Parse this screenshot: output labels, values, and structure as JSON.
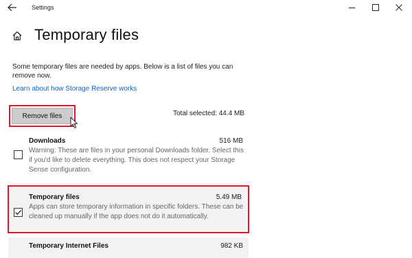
{
  "window": {
    "title": "Settings",
    "controls": {
      "minimize": "–",
      "maximize": "☐",
      "close": "✕"
    }
  },
  "page": {
    "title": "Temporary files",
    "description": "Some temporary files are needed by apps. Below is a list of files you can remove now.",
    "link": "Learn about how Storage Reserve works"
  },
  "actions": {
    "remove_label": "Remove files",
    "total_selected": "Total selected: 44.4 MB"
  },
  "items": [
    {
      "title": "Downloads",
      "size": "516 MB",
      "description": "Warning: These are files in your personal Downloads folder. Select this if you'd like to delete everything. This does not respect your Storage Sense configuration.",
      "checked": false
    },
    {
      "title": "Temporary files",
      "size": "5.49 MB",
      "description": "Apps can store temporary information in specific folders. These can be cleaned up manually if the app does not do it automatically.",
      "checked": true
    },
    {
      "title": "Temporary Internet Files",
      "size": "982 KB",
      "description": "",
      "checked": false
    }
  ],
  "colors": {
    "accent_link": "#0a63c9",
    "highlight": "#e3172a",
    "button_bg": "#cccccc",
    "selected_row_bg": "#f2f2f2"
  }
}
